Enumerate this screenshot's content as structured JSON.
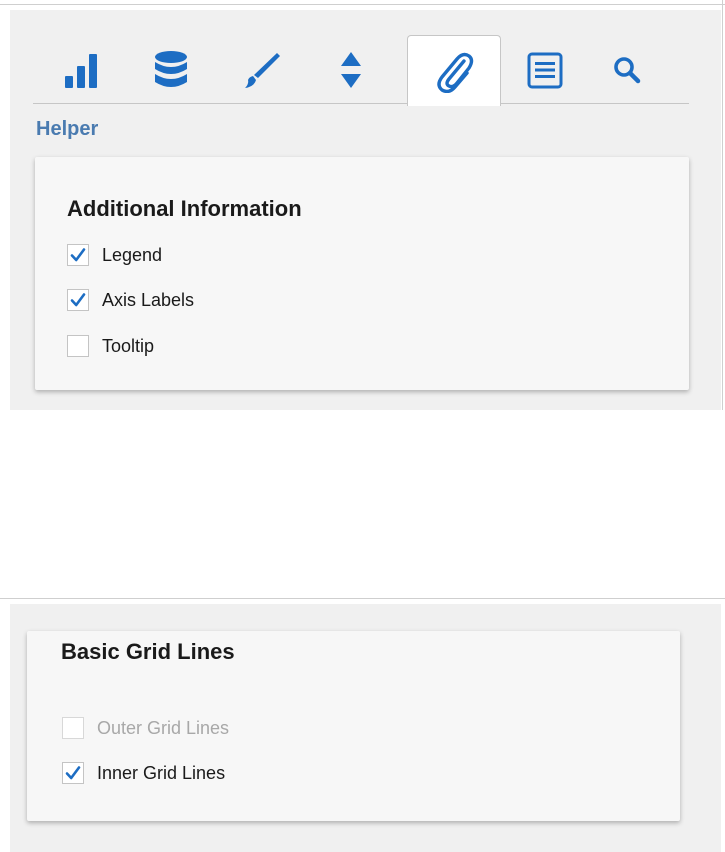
{
  "colors": {
    "accent": "#1d6dc3",
    "section_label": "#4a7bb0",
    "disabled_text": "#a8a8a8"
  },
  "toolbar": {
    "tabs": [
      {
        "icon": "bar-chart-icon",
        "active": false
      },
      {
        "icon": "database-icon",
        "active": false
      },
      {
        "icon": "paintbrush-icon",
        "active": false
      },
      {
        "icon": "sort-icon",
        "active": false
      },
      {
        "icon": "paperclip-icon",
        "active": true
      },
      {
        "icon": "list-icon",
        "active": false
      },
      {
        "icon": "search-icon",
        "active": false
      }
    ]
  },
  "section": {
    "label": "Helper"
  },
  "additional_info": {
    "title": "Additional Information",
    "options": [
      {
        "label": "Legend",
        "checked": true
      },
      {
        "label": "Axis Labels",
        "checked": true
      },
      {
        "label": "Tooltip",
        "checked": false
      }
    ]
  },
  "grid_lines": {
    "title": "Basic Grid Lines",
    "options": [
      {
        "label": "Outer Grid Lines",
        "checked": false,
        "disabled": true
      },
      {
        "label": "Inner Grid Lines",
        "checked": true,
        "disabled": false
      }
    ]
  }
}
